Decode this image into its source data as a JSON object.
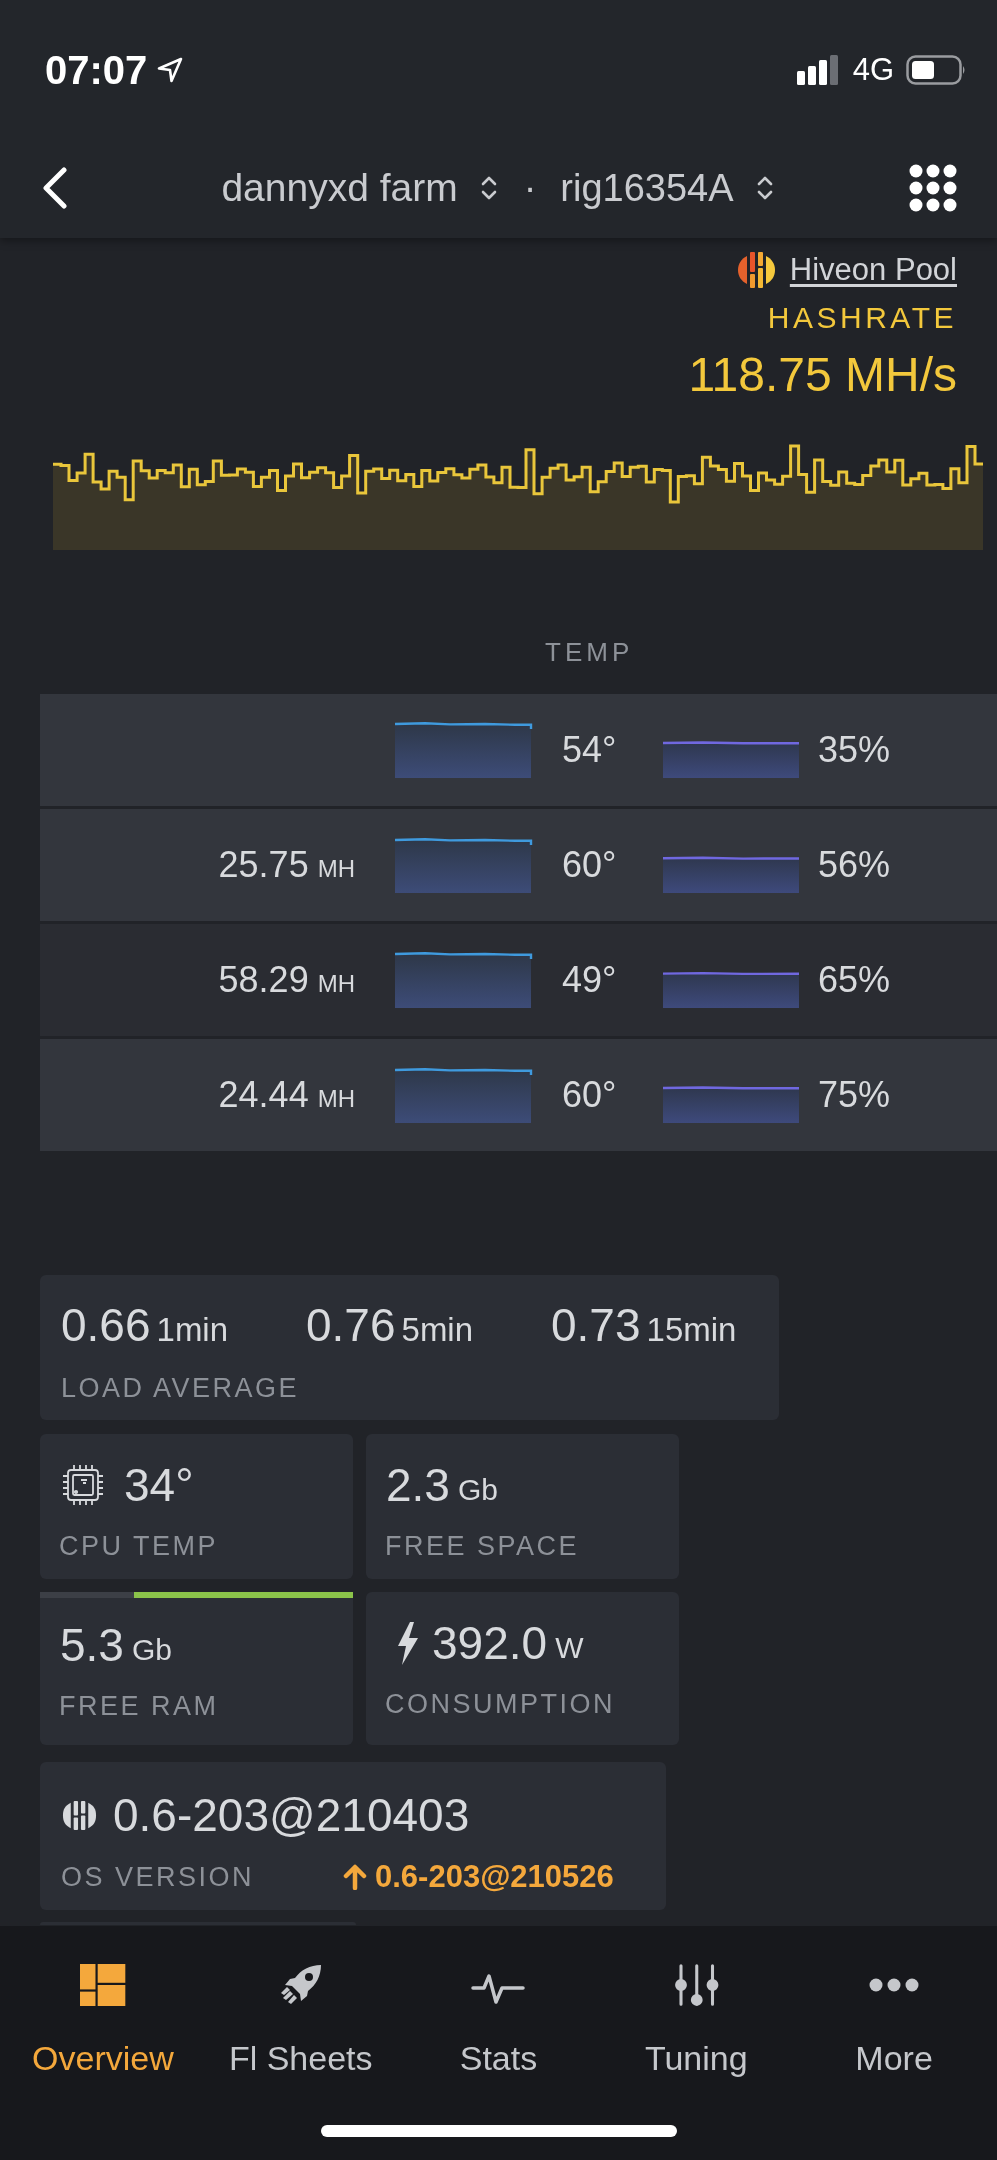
{
  "status_bar": {
    "time": "07:07",
    "network": "4G"
  },
  "header": {
    "farm": "dannyxd farm",
    "separator": "·",
    "rig": "rig16354A"
  },
  "pool": {
    "name": "Hiveon Pool"
  },
  "hashrate": {
    "label": "HASHRATE",
    "value": "118.75 MH/s"
  },
  "gpu_table": {
    "column_label": "TEMP",
    "rows": [
      {
        "temp": "54°",
        "fan": "35%"
      },
      {
        "hashrate": "25.75",
        "unit": "MH",
        "temp": "60°",
        "fan": "56%"
      },
      {
        "hashrate": "58.29",
        "unit": "MH",
        "temp": "49°",
        "fan": "65%"
      },
      {
        "hashrate": "24.44",
        "unit": "MH",
        "temp": "60°",
        "fan": "75%"
      }
    ]
  },
  "load_average": {
    "label": "LOAD AVERAGE",
    "values": [
      {
        "value": "0.66",
        "period": "1min"
      },
      {
        "value": "0.76",
        "period": "5min"
      },
      {
        "value": "0.73",
        "period": "15min"
      }
    ]
  },
  "stats": [
    {
      "kind": "cpu",
      "value": "34°",
      "label": "CPU TEMP"
    },
    {
      "kind": "plain",
      "value": "2.3",
      "unit": "Gb",
      "label": "FREE SPACE"
    },
    {
      "kind": "ram",
      "value": "5.3",
      "unit": "Gb",
      "label": "FREE RAM",
      "level": 0.7
    },
    {
      "kind": "power",
      "value": "392.0",
      "unit": "W",
      "label": "CONSUMPTION"
    }
  ],
  "os_version": {
    "value": "0.6-203@210403",
    "label": "OS VERSION",
    "update": "0.6-203@210526"
  },
  "tabs": [
    {
      "label": "Overview",
      "selected": true
    },
    {
      "label": "Fl Sheets",
      "selected": false
    },
    {
      "label": "Stats",
      "selected": false
    },
    {
      "label": "Tuning",
      "selected": false
    },
    {
      "label": "More",
      "selected": false
    }
  ]
}
